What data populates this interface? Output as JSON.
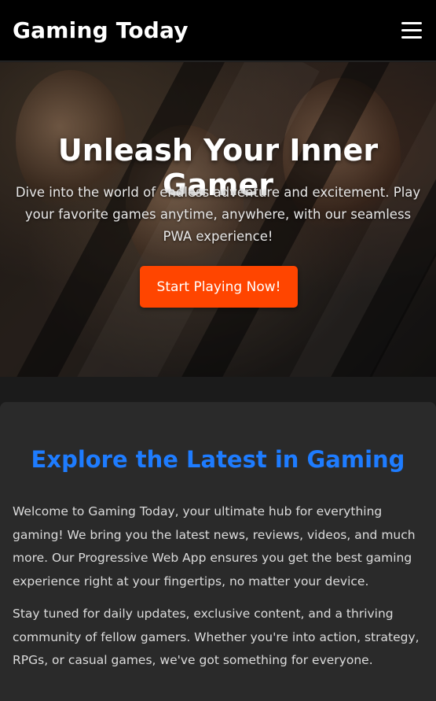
{
  "header": {
    "brand": "Gaming Today",
    "menu_icon": "hamburger-menu-icon"
  },
  "hero": {
    "title": "Unleash Your Inner Gamer",
    "text": "Dive into the world of endless adventure and excitement. Play your favorite games anytime, anywhere, with our seamless PWA experience!",
    "cta_label": "Start Playing Now!",
    "cta_color": "#ff4500"
  },
  "content": {
    "title": "Explore the Latest in Gaming",
    "title_color": "#1e7cff",
    "paragraphs": [
      "Welcome to Gaming Today, your ultimate hub for everything gaming! We bring you the latest news, reviews, videos, and much more. Our Progressive Web App ensures you get the best gaming experience right at your fingertips, no matter your device.",
      "Stay tuned for daily updates, exclusive content, and a thriving community of fellow gamers. Whether you're into action, strategy, RPGs, or casual games, we've got something for everyone."
    ]
  }
}
